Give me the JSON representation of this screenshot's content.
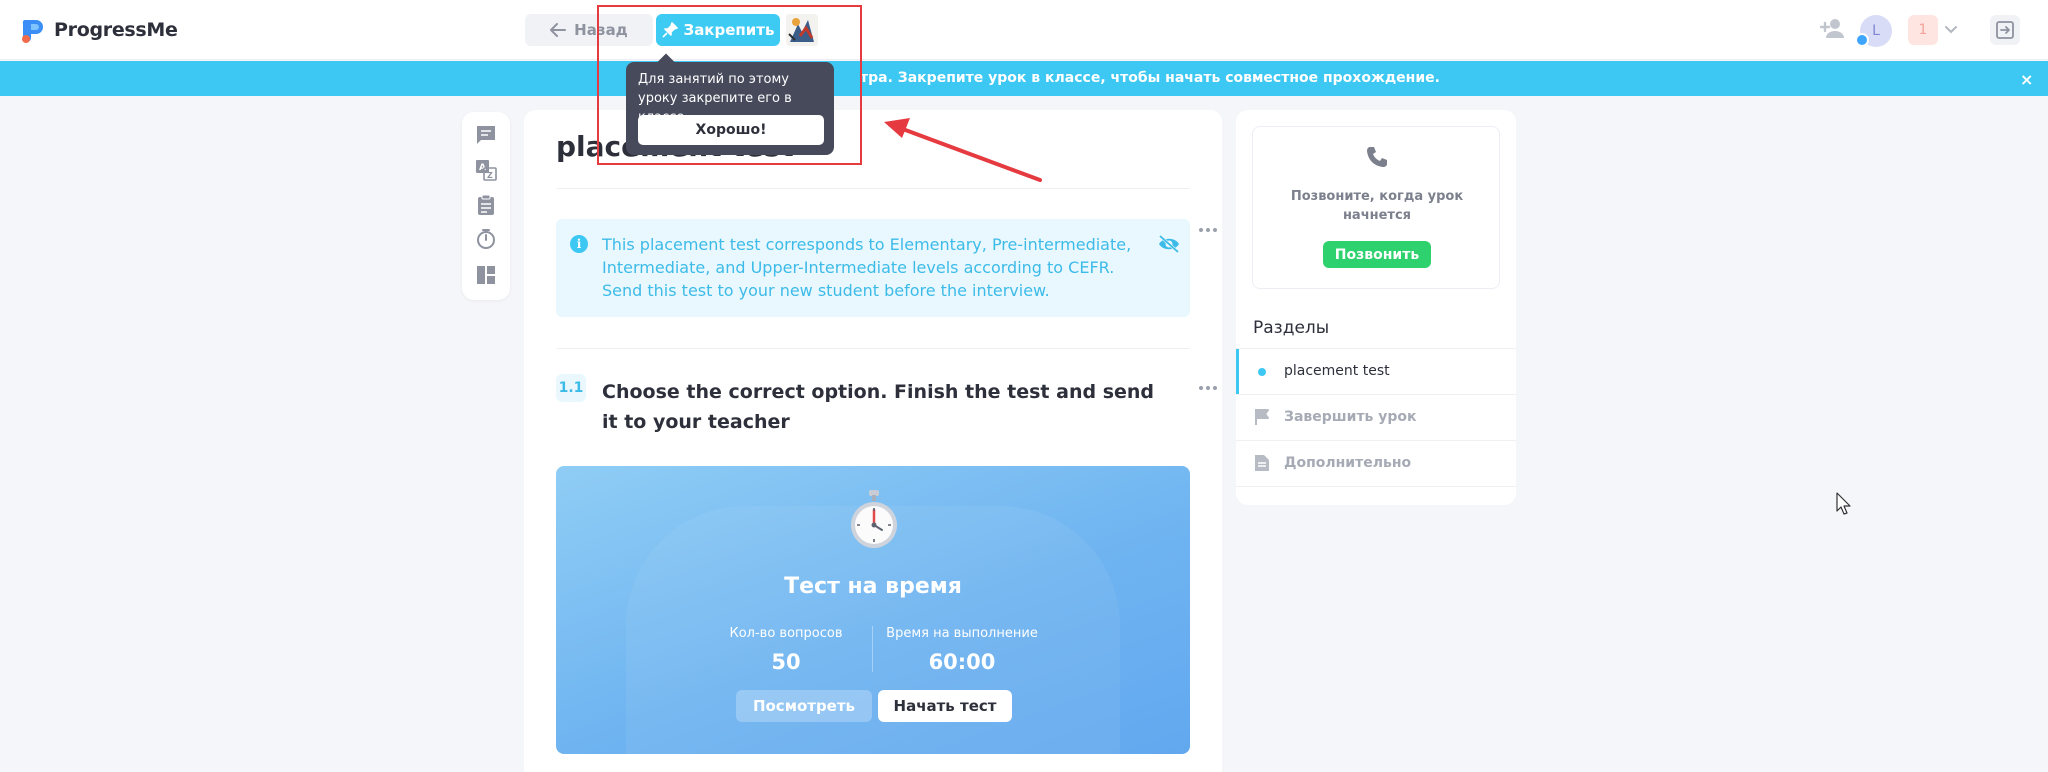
{
  "header": {
    "logo_text": "ProgressMe",
    "back_label": "Назад",
    "pin_label": "Закрепить",
    "avatar_letter": "L",
    "notification_count": "1"
  },
  "banner": {
    "text": "тра. Закрепите урок в классе, чтобы начать совместное прохождение.",
    "close": "×"
  },
  "tooltip": {
    "text": "Для занятий по этому уроку закрепите его в классе",
    "ok_label": "Хорошо!"
  },
  "lesson": {
    "title": "placement test",
    "info_lines": [
      "This placement test corresponds to Elementary, Pre-intermediate,",
      "Intermediate, and Upper-Intermediate levels according to CEFR.",
      "Send this test to your new student before the interview."
    ],
    "exercise_number": "1.1",
    "exercise_title": "Choose the correct option. Finish the test and send it to your teacher"
  },
  "timed_test": {
    "title": "Тест на время",
    "questions_label": "Кол-во вопросов",
    "questions_value": "50",
    "time_label": "Время на выполнение",
    "time_value": "60:00",
    "view_label": "Посмотреть",
    "start_label": "Начать тест"
  },
  "side": {
    "call_text_line1": "Позвоните, когда урок",
    "call_text_line2": "начнется",
    "call_button": "Позвонить",
    "sections_title": "Разделы",
    "sections": [
      {
        "label": "placement test",
        "icon": "dot-icon",
        "active": true
      },
      {
        "label": "Завершить урок",
        "icon": "flag-icon",
        "active": false
      },
      {
        "label": "Дополнительно",
        "icon": "document-icon",
        "active": false
      }
    ]
  },
  "colors": {
    "accent": "#3dc8f3",
    "call_green": "#2dd16d",
    "annotation_red": "#e53a40",
    "tooltip_bg": "#464a5b"
  }
}
